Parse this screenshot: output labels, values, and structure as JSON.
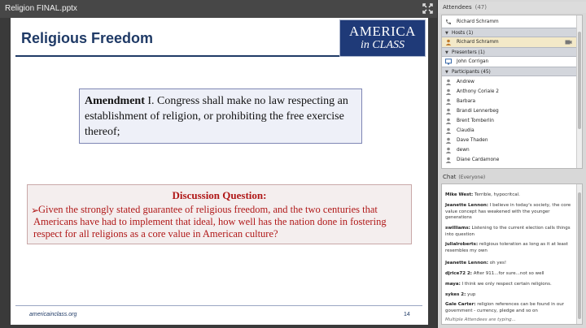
{
  "window": {
    "title": "Religion FINAL.pptx"
  },
  "slide": {
    "title": "Religious Freedom",
    "logo": {
      "line1": "AMERICA",
      "line2": "in CLASS"
    },
    "amendment": {
      "label": "Amendment",
      "text": " I. Congress shall make no law respecting an establishment of religion, or prohibiting the free exercise thereof;"
    },
    "discussion": {
      "heading": "Discussion Question:",
      "bullet": "➢",
      "text": "Given the strongly stated guarantee of religious freedom, and the two centuries that Americans have had to implement that ideal, how well has the nation done in fostering respect for all religions as a core value in American culture?"
    },
    "footer": {
      "site": "americainclass.org",
      "page": "14"
    }
  },
  "attendees": {
    "title": "Attendees",
    "count": "(47)",
    "me": "Richard Schramm",
    "hosts_label": "Hosts (1)",
    "hosts": [
      "Richard Schramm"
    ],
    "presenters_label": "Presenters (1)",
    "presenters": [
      "John Corrigan"
    ],
    "participants_label": "Participants (45)",
    "participants": [
      "Andrew",
      "Anthony Coriale 2",
      "Barbara",
      "Brandi Lennerbeg",
      "Brent Tomberlin",
      "Claudia",
      "Dave Thaden",
      "dewn",
      "Diane Cardamone"
    ]
  },
  "chat": {
    "title": "Chat",
    "scope": "(Everyone)",
    "messages": [
      {
        "who": "Mike West:",
        "text": " Terrible, hypocritcal."
      },
      {
        "who": "Jeanette Lennon:",
        "text": " I believe in today's society, the core value concept has weakened with the younger generations"
      },
      {
        "who": "swilliams:",
        "text": " Listening to the current election calls things into question"
      },
      {
        "who": "julialroberts:",
        "text": " religious toleration as long as it at least resembles my own"
      },
      {
        "who": "Jeanette Lennon:",
        "text": " oh yes!"
      },
      {
        "who": "djrice72 2:",
        "text": " After 911...for sure...not so well"
      },
      {
        "who": "maya:",
        "text": " I think we only respect certain religions."
      },
      {
        "who": "sykes 2:",
        "text": " yup"
      },
      {
        "who": "Gale Carter:",
        "text": " religion references can be found in our government - currency, pledge and so on"
      }
    ],
    "typing": "Multiple Attendees are typing..."
  }
}
